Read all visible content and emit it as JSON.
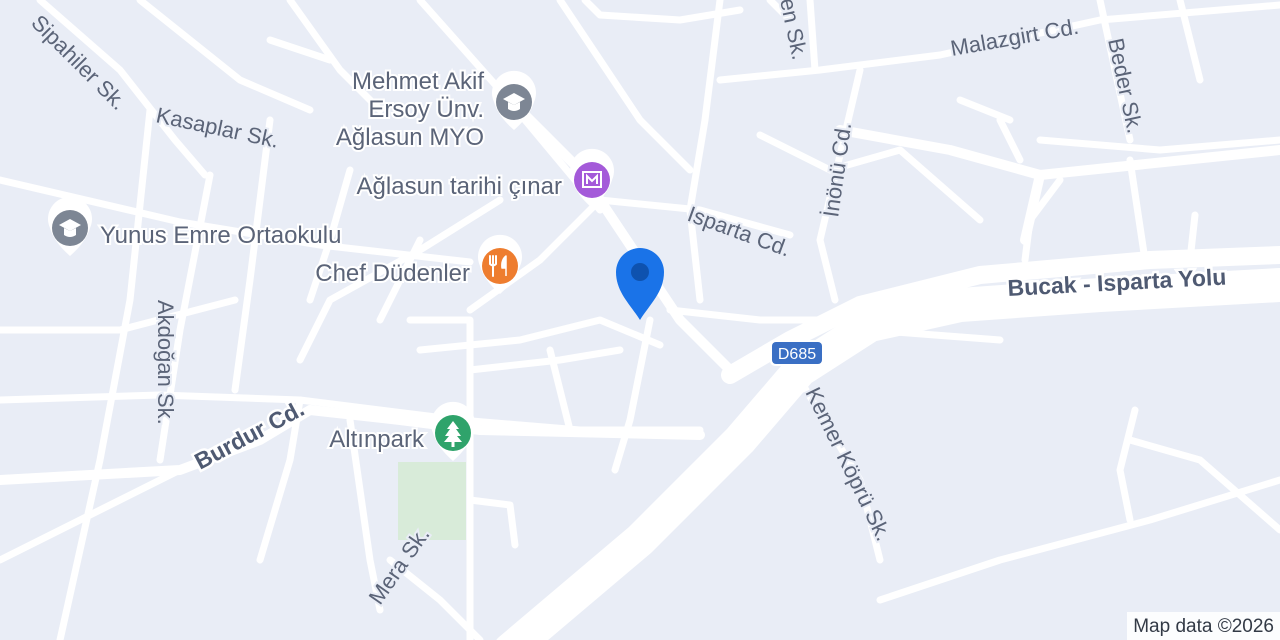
{
  "streets": {
    "malazgirt": "Malazgirt Cd.",
    "beder": "Beder Sk.",
    "en_sk": "en Sk.",
    "inonu": "İnönü Cd.",
    "isparta": "Isparta Cd.",
    "sipahiler": "Sipahiler Sk.",
    "kasaplar": "Kasaplar Sk.",
    "akdogan": "Akdoğan Sk.",
    "burdur": "Burdur Cd.",
    "kemer_kopru": "Kemer Köprü Sk.",
    "mera": "Mera Sk.",
    "bucak_isparta": "Bucak - Isparta Yolu"
  },
  "route_shield": {
    "label": "D685",
    "color": "#3a6fc4"
  },
  "pois": [
    {
      "name_lines": [
        "Mehmet Akif",
        "Ersoy Ünv.",
        "Ağlasun MYO"
      ],
      "icon": "graduation-cap-icon",
      "color": "#7d8694"
    },
    {
      "name_lines": [
        "Ağlasun tarihi çınar"
      ],
      "icon": "museum-icon",
      "color": "#a45ad9"
    },
    {
      "name_lines": [
        "Yunus Emre Ortaokulu"
      ],
      "icon": "graduation-cap-icon",
      "color": "#7d8694"
    },
    {
      "name_lines": [
        "Chef Düdenler"
      ],
      "icon": "restaurant-icon",
      "color": "#ee7d2f"
    },
    {
      "name_lines": [
        "Altınpark"
      ],
      "icon": "tree-icon",
      "color": "#2fa36b"
    }
  ],
  "location_marker": {
    "icon": "location-pin-icon",
    "color": "#1a73e8"
  },
  "attribution": "Map data ©2026"
}
